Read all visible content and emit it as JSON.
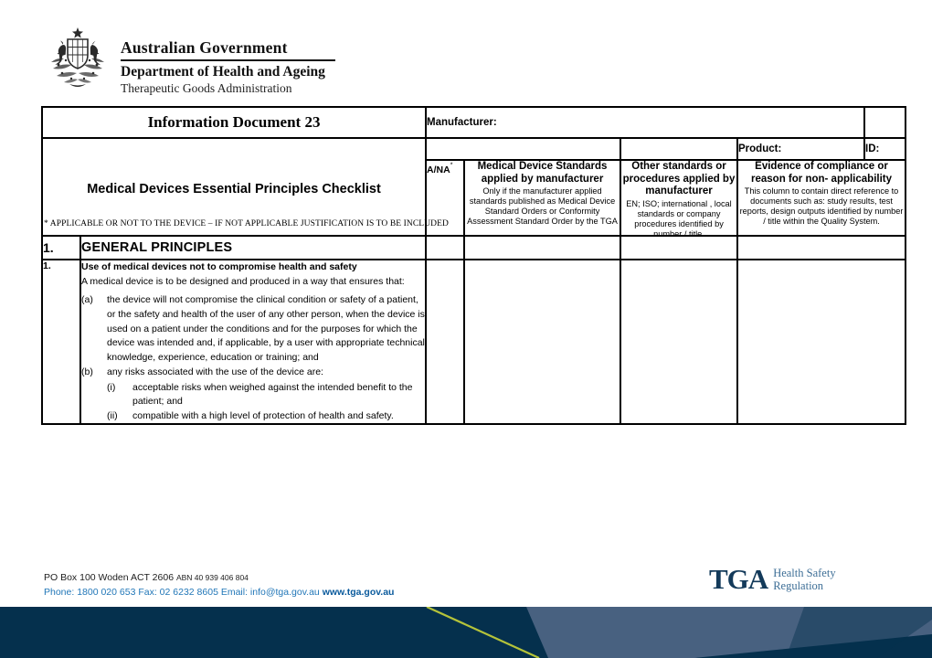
{
  "masthead": {
    "crest_icon": "australian-coat-of-arms",
    "line1": "Australian Government",
    "line2": "Department of Health and Ageing",
    "line3": "Therapeutic Goods Administration"
  },
  "doc_header": {
    "document_title": "Information Document 23",
    "document_subtitle": "Medical Devices Essential Principles Checklist",
    "manufacturer_label": "Manufacturer:",
    "manufacturer_value": "",
    "product_label": "Product:",
    "product_value": "",
    "id_label": "ID:",
    "id_value": "",
    "columns": [
      {
        "title": "A/NA",
        "asterisk": "*",
        "subtitle": ""
      },
      {
        "title": "Medical Device Standards applied by manufacturer",
        "subtitle": "Only if the manufacturer applied standards published as Medical Device Standard Orders or Conformity Assessment Standard Order by the TGA"
      },
      {
        "title": "Other standards or procedures applied by manufacturer",
        "subtitle": "EN; ISO; international ,  local standards or company procedures identified by number / title."
      },
      {
        "title": "Evidence of compliance or reason for non- applicability",
        "subtitle": "This column to contain direct reference to documents such as: study results, test reports, design outputs identified by number / title within the Quality System."
      }
    ]
  },
  "note": "* APPLICABLE  OR NOT TO THE DEVICE – IF NOT APPLICABLE JUSTIFICATION IS TO BE INCLUDED",
  "sections": [
    {
      "number": "1.",
      "title": "GENERAL PRINCIPLES",
      "items": [
        {
          "number": "1.",
          "heading": "Use of medical devices not to compromise health and safety",
          "lead": "A medical device is to be designed and produced in a way that ensures that:",
          "subitems": [
            {
              "mark": "(a)",
              "text": "the device will not compromise the clinical condition or safety of a patient, or the safety and health of the user of any other person, when the device is used on a patient under the conditions and for the purposes for which the device was intended and, if applicable, by a user with appropriate technical knowledge, experience, education or training; and"
            },
            {
              "mark": "(b)",
              "text": "any risks associated with the use of the device are:",
              "romans": [
                {
                  "mark": "(i)",
                  "text": "acceptable risks when weighed against the intended benefit to the patient; and"
                },
                {
                  "mark": "(ii)",
                  "text": "compatible with a high level of protection of health and safety."
                }
              ]
            }
          ],
          "ana_value": "",
          "standards_value": "",
          "other_standards_value": "",
          "evidence_value": ""
        }
      ]
    }
  ],
  "footer": {
    "address": "PO Box 100  Woden ACT 2606",
    "abn": "ABN 40 939 406 804",
    "contact": "Phone: 1800 020 653  Fax: 02 6232 8605  Email: info@tga.gov.au",
    "url": "www.tga.gov.au"
  },
  "logo": {
    "wordmark": "TGA",
    "tagline_line1": "Health Safety",
    "tagline_line2": "Regulation"
  },
  "colors": {
    "band_dark": "#05304d",
    "band_slate": "#4e6684",
    "band_green_line": "#b5c33a",
    "section_gray": "#b3b3b3",
    "logo_navy": "#133a5a",
    "logo_blue": "#3d6e96",
    "footer_blue": "#2277b8",
    "footer_url_blue": "#0a5a9c"
  }
}
